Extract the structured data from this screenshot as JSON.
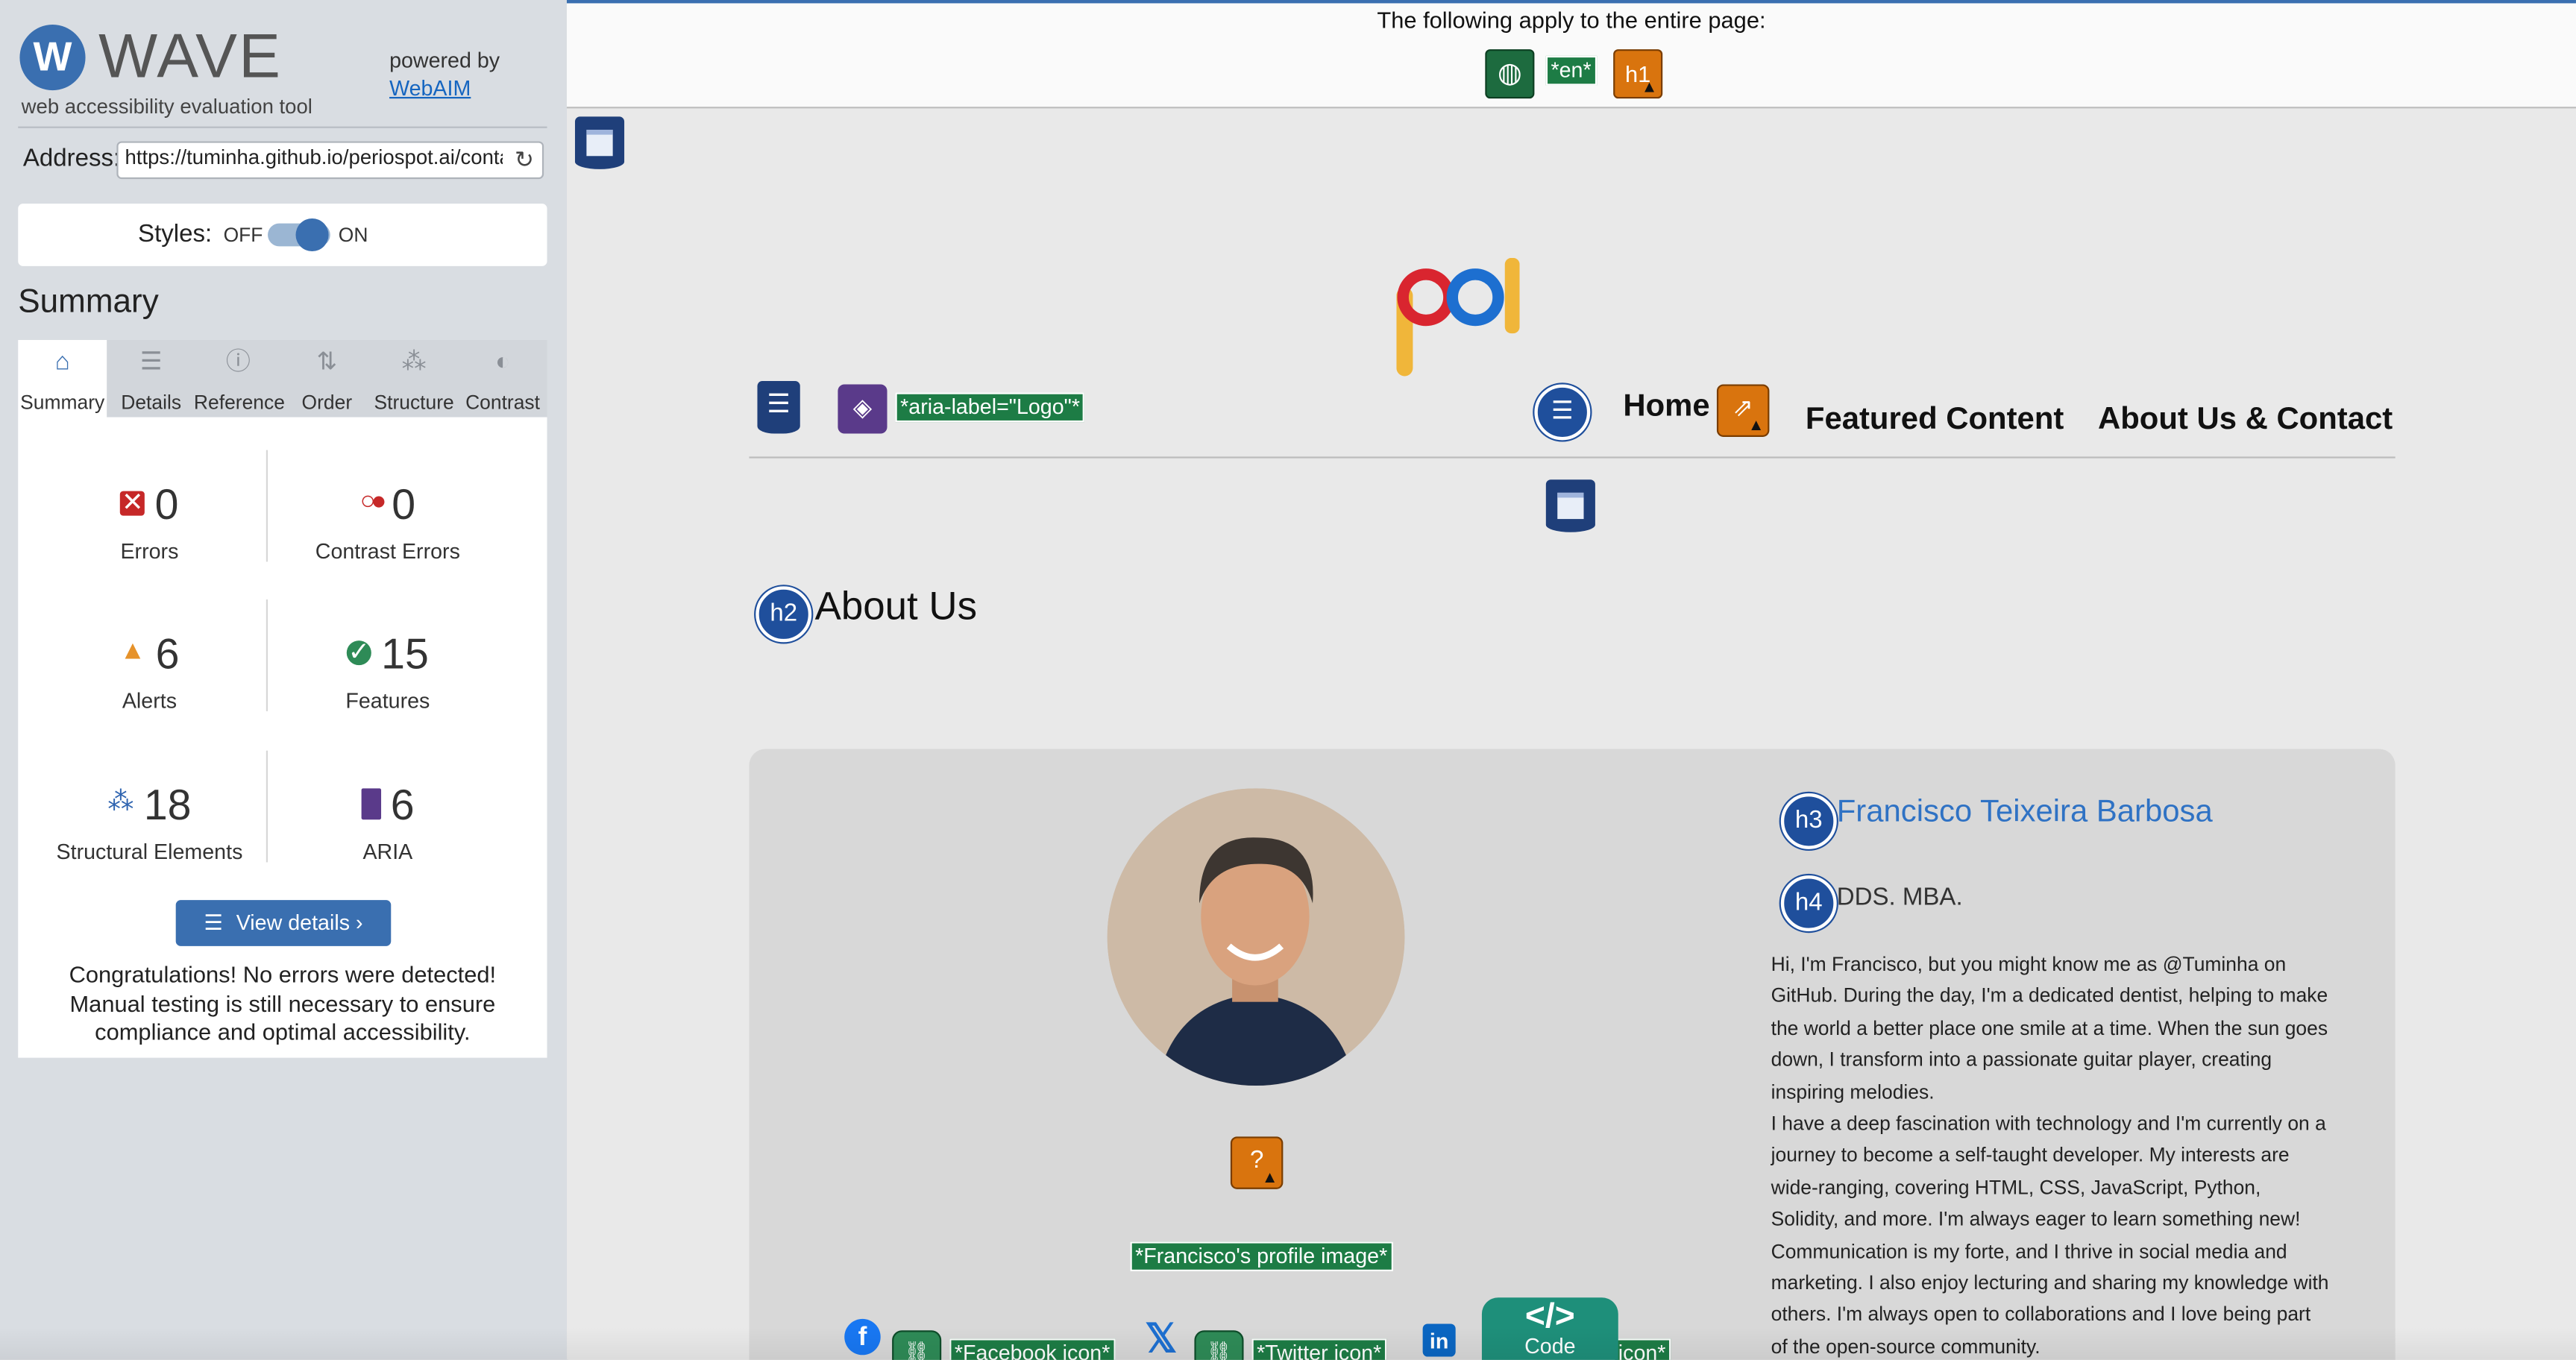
{
  "wave": {
    "logo_letter": "W",
    "logo_name": "WAVE",
    "logo_subtitle": "web accessibility evaluation tool",
    "powered_by": "powered by",
    "powered_link": "WebAIM",
    "address_label": "Address:",
    "address_value": "https://tuminha.github.io/periospot.ai/contact",
    "styles_label": "Styles:",
    "styles_off": "OFF",
    "styles_on": "ON",
    "styles_state": "on",
    "summary_heading": "Summary",
    "tabs": [
      {
        "label": "Summary",
        "icon": "home-icon",
        "glyph": "⌂"
      },
      {
        "label": "Details",
        "icon": "list-icon",
        "glyph": "☰"
      },
      {
        "label": "Reference",
        "icon": "info-icon",
        "glyph": "ⓘ"
      },
      {
        "label": "Order",
        "icon": "order-icon",
        "glyph": "⇅"
      },
      {
        "label": "Structure",
        "icon": "structure-icon",
        "glyph": "⁂"
      },
      {
        "label": "Contrast",
        "icon": "contrast-icon",
        "glyph": "◐"
      }
    ],
    "stats": {
      "errors": {
        "value": "0",
        "label": "Errors"
      },
      "contrast_errors": {
        "value": "0",
        "label": "Contrast Errors"
      },
      "alerts": {
        "value": "6",
        "label": "Alerts"
      },
      "features": {
        "value": "15",
        "label": "Features"
      },
      "structural": {
        "value": "18",
        "label": "Structural Elements"
      },
      "aria": {
        "value": "6",
        "label": "ARIA"
      }
    },
    "view_details": "View details ›",
    "congrats": "Congratulations! No errors were detected! Manual testing is still necessary to ensure compliance and optimal accessibility."
  },
  "page": {
    "applies_text": "The following apply to the entire page:",
    "lang_label": "*en*",
    "h1_label": "h1",
    "aria_logo_label": "*aria-label=\"Logo\"*",
    "nav": {
      "home": "Home",
      "featured": "Featured Content",
      "about": "About Us & Contact"
    },
    "h2_label": "h2",
    "h2_text": "About Us",
    "h3_label": "h3",
    "h3_text": "Francisco Teixeira Barbosa",
    "h4_label": "h4",
    "h4_text": "DDS. MBA.",
    "bio": [
      "Hi, I'm Francisco, but you might know me as @Tuminha on GitHub. During the day, I'm a dedicated dentist, helping to make the world a better place one smile at a time. When the sun goes down, I transform into a passionate guitar player, creating inspiring melodies.",
      "I have a deep fascination with technology and I'm currently on a journey to become a self-taught developer. My interests are wide-ranging, covering HTML, CSS, JavaScript, Python, Solidity, and more. I'm always eager to learn something new!",
      "Communication is my forte, and I thrive in social media and marketing. I also enjoy lecturing and sharing my knowledge with others. I'm always open to collaborations and I love being part of the open-source community."
    ],
    "profile_alt_label": "*Francisco's profile image*",
    "social": {
      "facebook_label": "*Facebook icon*",
      "twitter_label": "*Twitter icon*",
      "linkedin_label": "icon*"
    },
    "code_label": "Code",
    "code_symbol": "</>"
  },
  "colors": {
    "wave_blue": "#3a6fb0",
    "error_red": "#c62828",
    "alert_orange": "#e6922a",
    "feature_green": "#2e8b57",
    "aria_purple": "#5a3a8a",
    "h3_blue": "#2f72c4"
  }
}
